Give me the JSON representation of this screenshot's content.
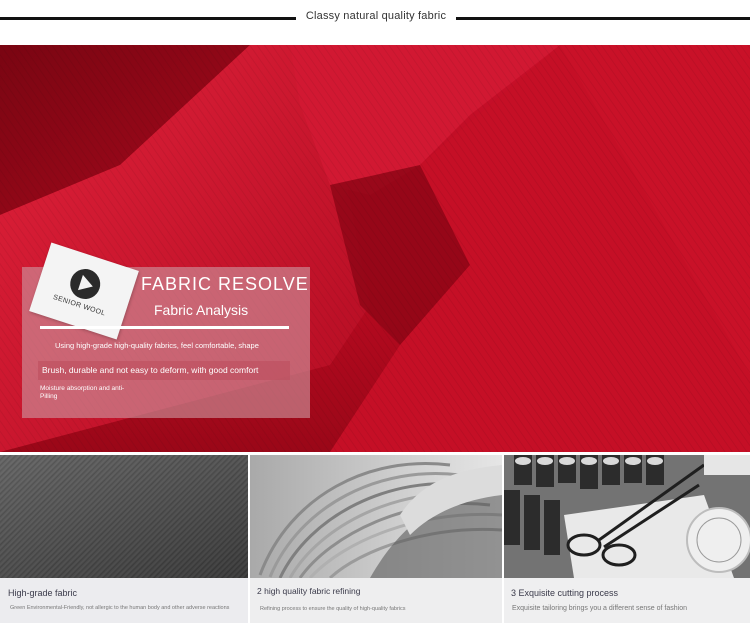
{
  "header": {
    "title": "Classy natural quality fabric"
  },
  "hero": {
    "logo_text": "SENIOR WOOL",
    "heading": "FABRIC RESOLVE",
    "subheading": "Fabric Analysis",
    "line1": "Using high-grade high-quality fabrics, feel comfortable, shape",
    "line2": "Brush, durable and not easy to deform, with good comfort",
    "line3": "Moisture absorption and anti-Pilling"
  },
  "features": [
    {
      "title": "High-grade fabric",
      "subtitle": "Green Environmental-Friendly, not allergic to the human body and other adverse reactions"
    },
    {
      "title": "2 high quality fabric refining",
      "subtitle": "Refining process to ensure the quality of high-quality fabrics"
    },
    {
      "title": "3 Exquisite cutting process",
      "subtitle": "Exquisite tailoring brings you a different sense of fashion"
    }
  ],
  "colors": {
    "fabric_red": "#c8102a",
    "panel_overlay": "#cd96a0"
  }
}
